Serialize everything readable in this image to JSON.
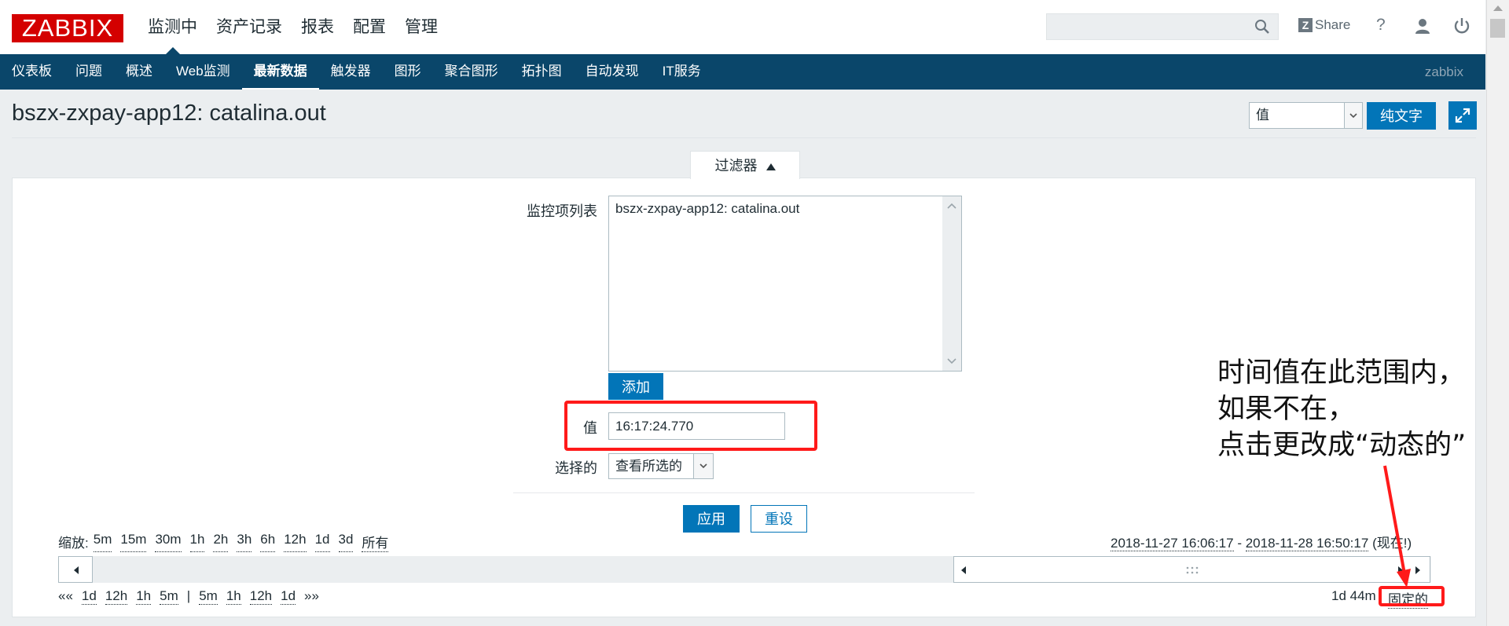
{
  "header": {
    "logo": "ZABBIX",
    "main_nav": [
      "监测中",
      "资产记录",
      "报表",
      "配置",
      "管理"
    ],
    "share_label": "Share",
    "share_badge": "Z",
    "help_label": "?"
  },
  "subnav": {
    "items": [
      "仪表板",
      "问题",
      "概述",
      "Web监测",
      "最新数据",
      "触发器",
      "图形",
      "聚合图形",
      "拓扑图",
      "自动发现",
      "IT服务"
    ],
    "server": "zabbix"
  },
  "page": {
    "title": "bszx-zxpay-app12: catalina.out",
    "view_select": "值",
    "plain_text_button": "纯文字"
  },
  "filter": {
    "tab_label": "过滤器",
    "items_label": "监控项列表",
    "items": [
      "bszx-zxpay-app12: catalina.out"
    ],
    "add_button": "添加",
    "value_label": "值",
    "value": "16:17:24.770",
    "select_label": "选择的",
    "select_value": "查看所选的",
    "apply_button": "应用",
    "reset_button": "重设"
  },
  "timeline": {
    "zoom_label": "缩放:",
    "zoom_options": [
      "5m",
      "15m",
      "30m",
      "1h",
      "2h",
      "3h",
      "6h",
      "12h",
      "1d",
      "3d",
      "所有"
    ],
    "range_start": "2018-11-27 16:06:17",
    "range_sep": " - ",
    "range_end": "2018-11-28 16:50:17",
    "range_now": "(现在!)",
    "back_fast": "««",
    "back_options": [
      "1d",
      "12h",
      "1h",
      "5m"
    ],
    "separator": "|",
    "forward_options": [
      "5m",
      "1h",
      "12h",
      "1d"
    ],
    "forward_fast": "»»",
    "duration": "1d 44m",
    "mode": "固定的"
  },
  "annotation": {
    "text": "时间值在此范围内，\n如果不在，\n点击更改成“动态的”"
  },
  "colors": {
    "brand_red": "#d40000",
    "nav_blue": "#0a466a",
    "button_blue": "#0275b8",
    "annotation_red": "#ff1a1a"
  }
}
